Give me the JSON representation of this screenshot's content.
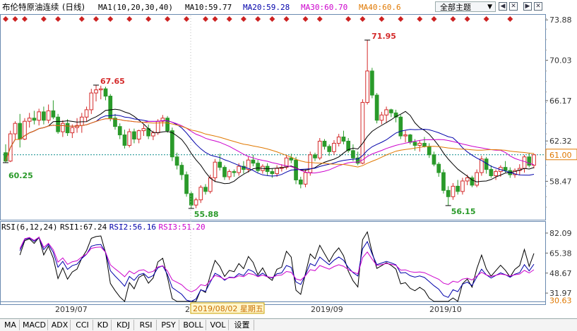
{
  "header": {
    "instrument": "布伦特原油连续",
    "period": "(日线)",
    "ma_label": "MA1(10,20,30,40)",
    "ma10": "MA10:59.77",
    "ma20": "MA20:59.28",
    "ma30": "MA30:60.70",
    "ma40": "MA40:60.6",
    "theme_button": "全部主题",
    "theme_arrow": "▼",
    "window_buttons": [
      "◀",
      "✕",
      "▶",
      "✕"
    ]
  },
  "rsi_header": {
    "label": "RSI(6,12,24)",
    "rsi1": "RSI1:67.24",
    "rsi2": "RSI2:56.16",
    "rsi3": "RSI3:51.20"
  },
  "colors": {
    "up": "#d42a2a",
    "down": "#2a9a2a",
    "ma10": "#000000",
    "ma20": "#0000aa",
    "ma30": "#cc00cc",
    "ma40": "#e07800",
    "current_price_line": "#0a8a8a",
    "event_marker": "#cc2222"
  },
  "price_axis": {
    "ticks": [
      "73.88",
      "70.03",
      "66.17",
      "62.32",
      "58.47"
    ],
    "current_price": "61.00"
  },
  "rsi_axis": {
    "ticks": [
      "82.09",
      "65.38",
      "48.67",
      "31.97"
    ],
    "current": "30.63"
  },
  "date_axis": {
    "labels": [
      "2019/07",
      "2019/09",
      "2019/10"
    ],
    "crosshair_date": "2019/08/02 星期五",
    "crosshair_prefix": "2"
  },
  "annotations": {
    "high1": "67.65",
    "low1": "60.25",
    "low2": "55.88",
    "high2": "71.95",
    "low3": "56.15"
  },
  "tabs": [
    "MA",
    "MACD",
    "ADX",
    "CCI",
    "KD",
    "KDJ",
    "RSI",
    "PSY",
    "BOLL",
    "VOL",
    "设置"
  ],
  "chart_data": {
    "type": "candlestick",
    "price_ylim": [
      54.8,
      74.3
    ],
    "rsi_ylim": [
      25,
      85
    ],
    "ohlc": [
      [
        61.2,
        62.0,
        60.25,
        60.4
      ],
      [
        60.4,
        63.3,
        60.3,
        63.0
      ],
      [
        63.0,
        64.2,
        62.5,
        64.0
      ],
      [
        64.0,
        64.9,
        61.7,
        62.5
      ],
      [
        62.5,
        64.5,
        62.4,
        64.2
      ],
      [
        64.2,
        65.0,
        63.6,
        64.5
      ],
      [
        64.5,
        65.2,
        63.9,
        64.3
      ],
      [
        64.3,
        65.4,
        63.8,
        65.1
      ],
      [
        65.1,
        65.6,
        63.9,
        64.3
      ],
      [
        64.3,
        65.8,
        64.0,
        65.2
      ],
      [
        65.2,
        66.2,
        64.4,
        64.6
      ],
      [
        64.6,
        64.9,
        63.0,
        63.2
      ],
      [
        63.2,
        64.3,
        62.7,
        64.0
      ],
      [
        64.0,
        64.4,
        62.8,
        63.1
      ],
      [
        63.1,
        63.9,
        62.6,
        63.6
      ],
      [
        63.6,
        64.5,
        63.1,
        63.8
      ],
      [
        63.8,
        65.0,
        63.1,
        64.6
      ],
      [
        64.6,
        65.6,
        64.2,
        65.3
      ],
      [
        65.3,
        67.3,
        64.9,
        66.9
      ],
      [
        66.9,
        67.65,
        66.1,
        67.2
      ],
      [
        67.2,
        67.6,
        66.3,
        67.3
      ],
      [
        67.3,
        67.5,
        66.2,
        66.6
      ],
      [
        66.6,
        66.8,
        64.2,
        64.5
      ],
      [
        64.5,
        64.9,
        63.4,
        63.7
      ],
      [
        63.7,
        64.0,
        62.5,
        62.9
      ],
      [
        62.9,
        63.4,
        61.6,
        61.9
      ],
      [
        61.9,
        63.5,
        61.7,
        63.2
      ],
      [
        63.2,
        63.5,
        62.1,
        62.5
      ],
      [
        62.5,
        63.4,
        62.1,
        63.3
      ],
      [
        63.3,
        63.9,
        62.8,
        63.5
      ],
      [
        63.5,
        63.9,
        62.5,
        62.8
      ],
      [
        62.8,
        63.3,
        62.4,
        63.1
      ],
      [
        63.1,
        64.4,
        62.9,
        64.2
      ],
      [
        64.2,
        64.8,
        63.7,
        64.5
      ],
      [
        64.5,
        64.7,
        63.1,
        63.3
      ],
      [
        63.3,
        63.6,
        60.4,
        60.8
      ],
      [
        60.8,
        61.2,
        59.6,
        60.0
      ],
      [
        60.0,
        60.3,
        58.6,
        59.1
      ],
      [
        59.1,
        59.4,
        57.0,
        57.3
      ],
      [
        57.3,
        57.5,
        55.88,
        56.2
      ],
      [
        56.2,
        56.9,
        55.9,
        56.7
      ],
      [
        56.7,
        58.1,
        56.4,
        57.9
      ],
      [
        57.9,
        58.2,
        57.2,
        57.5
      ],
      [
        57.5,
        59.1,
        57.3,
        58.8
      ],
      [
        58.8,
        60.6,
        58.4,
        60.3
      ],
      [
        60.3,
        61.1,
        59.5,
        59.8
      ],
      [
        59.8,
        60.0,
        58.6,
        58.9
      ],
      [
        58.9,
        59.6,
        58.6,
        59.4
      ],
      [
        59.4,
        59.6,
        58.9,
        59.3
      ],
      [
        59.3,
        60.2,
        59.0,
        59.9
      ],
      [
        59.9,
        60.4,
        59.2,
        59.6
      ],
      [
        59.6,
        60.8,
        59.3,
        60.5
      ],
      [
        60.5,
        61.0,
        59.9,
        60.2
      ],
      [
        60.2,
        60.5,
        59.3,
        59.5
      ],
      [
        59.5,
        60.1,
        59.2,
        59.9
      ],
      [
        59.9,
        60.2,
        59.0,
        59.4
      ],
      [
        59.4,
        59.7,
        58.8,
        59.2
      ],
      [
        59.2,
        60.0,
        58.9,
        59.7
      ],
      [
        59.7,
        60.1,
        59.4,
        59.8
      ],
      [
        59.8,
        61.0,
        59.6,
        60.7
      ],
      [
        60.7,
        61.1,
        60.2,
        60.5
      ],
      [
        60.5,
        60.8,
        58.2,
        58.6
      ],
      [
        58.6,
        58.9,
        57.8,
        58.2
      ],
      [
        58.2,
        59.6,
        57.9,
        59.3
      ],
      [
        59.3,
        61.3,
        59.0,
        61.0
      ],
      [
        61.0,
        61.2,
        60.4,
        60.7
      ],
      [
        60.7,
        62.6,
        60.5,
        62.3
      ],
      [
        62.3,
        62.5,
        61.5,
        61.8
      ],
      [
        61.8,
        62.0,
        60.9,
        61.3
      ],
      [
        61.3,
        62.4,
        61.0,
        62.1
      ],
      [
        62.1,
        63.0,
        61.8,
        62.7
      ],
      [
        62.7,
        63.3,
        62.0,
        62.3
      ],
      [
        62.3,
        62.6,
        61.2,
        61.4
      ],
      [
        61.4,
        62.0,
        60.4,
        60.7
      ],
      [
        60.7,
        61.3,
        60.0,
        60.2
      ],
      [
        60.2,
        66.3,
        60.1,
        66.0
      ],
      [
        66.0,
        71.95,
        65.8,
        69.0
      ],
      [
        69.0,
        69.3,
        66.4,
        66.7
      ],
      [
        66.7,
        66.9,
        64.0,
        64.3
      ],
      [
        64.3,
        65.1,
        63.9,
        64.8
      ],
      [
        64.8,
        65.6,
        64.1,
        65.3
      ],
      [
        65.3,
        65.4,
        64.6,
        65.0
      ],
      [
        65.0,
        65.3,
        64.1,
        64.6
      ],
      [
        64.6,
        64.8,
        62.5,
        62.8
      ],
      [
        62.8,
        63.3,
        62.2,
        62.9
      ],
      [
        62.9,
        63.0,
        62.0,
        62.2
      ],
      [
        62.2,
        62.5,
        61.4,
        61.9
      ],
      [
        61.9,
        62.4,
        61.3,
        62.1
      ],
      [
        62.1,
        62.7,
        61.7,
        61.8
      ],
      [
        61.8,
        62.1,
        60.7,
        61.0
      ],
      [
        61.0,
        61.3,
        59.9,
        60.1
      ],
      [
        60.1,
        60.3,
        58.9,
        59.3
      ],
      [
        59.3,
        59.6,
        57.3,
        57.6
      ],
      [
        57.6,
        58.0,
        56.15,
        57.0
      ],
      [
        57.0,
        58.3,
        56.7,
        58.0
      ],
      [
        58.0,
        58.6,
        57.2,
        57.5
      ],
      [
        57.5,
        58.8,
        57.2,
        58.5
      ],
      [
        58.5,
        59.1,
        58.1,
        58.8
      ],
      [
        58.8,
        59.0,
        57.9,
        58.1
      ],
      [
        58.1,
        59.6,
        57.9,
        59.3
      ],
      [
        59.3,
        60.9,
        59.0,
        60.6
      ],
      [
        60.6,
        60.8,
        59.2,
        59.6
      ],
      [
        59.6,
        60.0,
        58.8,
        59.0
      ],
      [
        59.0,
        59.6,
        58.6,
        59.4
      ],
      [
        59.4,
        60.0,
        58.9,
        59.8
      ],
      [
        59.8,
        60.4,
        59.3,
        59.5
      ],
      [
        59.5,
        59.8,
        58.8,
        59.1
      ],
      [
        59.1,
        59.7,
        58.8,
        59.5
      ],
      [
        59.5,
        60.1,
        59.1,
        59.7
      ],
      [
        59.7,
        61.0,
        59.3,
        60.8
      ],
      [
        60.8,
        61.2,
        59.8,
        60.0
      ],
      [
        60.0,
        61.1,
        59.7,
        61.0
      ]
    ],
    "series": [
      {
        "name": "MA10",
        "period": 10
      },
      {
        "name": "MA20",
        "period": 20
      },
      {
        "name": "MA30",
        "period": 30
      },
      {
        "name": "MA40",
        "period": 40
      },
      {
        "name": "RSI1",
        "period": 6
      },
      {
        "name": "RSI2",
        "period": 12
      },
      {
        "name": "RSI3",
        "period": 24
      }
    ],
    "event_marker_bars": [
      0,
      2,
      4,
      8,
      11,
      16,
      19,
      22,
      26,
      30,
      34,
      38,
      42,
      44,
      47,
      50,
      53,
      56,
      59,
      63,
      66,
      72,
      75,
      79,
      83,
      87,
      90,
      94,
      97,
      101,
      106
    ]
  }
}
